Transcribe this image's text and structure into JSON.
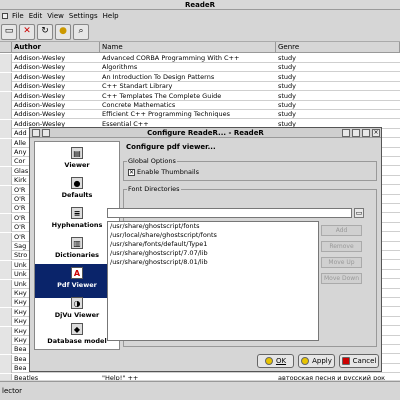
{
  "app": {
    "title": "ReadeR"
  },
  "menu": {
    "items": [
      "File",
      "Edit",
      "View",
      "Settings",
      "Help"
    ]
  },
  "toolbar": {
    "buttons": [
      "new-icon",
      "delete-icon",
      "refresh-icon",
      "search-icon",
      "find-icon"
    ]
  },
  "table": {
    "headers": [
      "Author",
      "Name",
      "Genre"
    ],
    "rows": [
      [
        "Addison-Wesley",
        "Advanced CORBA Programming With C++",
        "study"
      ],
      [
        "Addison-Wesley",
        "Algorithms",
        "study"
      ],
      [
        "Addison-Wesley",
        "An Introduction To Design Patterns",
        "study"
      ],
      [
        "Addison-Wesley",
        "C++ Standart Library",
        "study"
      ],
      [
        "Addison-Wesley",
        "C++ Templates The Complete Guide",
        "study"
      ],
      [
        "Addison-Wesley",
        "Concrete Mathematics",
        "study"
      ],
      [
        "Addison-Wesley",
        "Efficient C++ Programming Techniques",
        "study"
      ],
      [
        "Addison-Wesley",
        "Essential C++",
        "study"
      ],
      [
        "Add",
        "",
        ""
      ],
      [
        "Alle",
        "",
        ""
      ],
      [
        "Any",
        "",
        ""
      ],
      [
        "Cor",
        "",
        ""
      ],
      [
        "Glas",
        "",
        ""
      ],
      [
        "Kirk",
        "",
        ""
      ],
      [
        "O'R",
        "",
        ""
      ],
      [
        "O'R",
        "",
        ""
      ],
      [
        "O'R",
        "",
        ""
      ],
      [
        "O'R",
        "",
        ""
      ],
      [
        "O'R",
        "",
        ""
      ],
      [
        "O'R",
        "",
        ""
      ],
      [
        "Sag",
        "",
        ""
      ],
      [
        "Stro",
        "",
        ""
      ],
      [
        "Unk",
        "",
        ""
      ],
      [
        "Unk",
        "",
        ""
      ],
      [
        "Unk",
        "",
        ""
      ],
      [
        "Кну",
        "",
        ""
      ],
      [
        "Кну",
        "",
        ""
      ],
      [
        "Кну",
        "",
        ""
      ],
      [
        "Кну",
        "",
        ""
      ],
      [
        "Кну",
        "",
        ""
      ],
      [
        "Кну",
        "",
        ""
      ],
      [
        "Bea",
        "",
        ""
      ],
      [
        "Bea",
        "",
        ""
      ],
      [
        "Bea",
        "",
        ""
      ],
      [
        "Beatles",
        "\"Help!\" ++",
        "авторская песня и русский рок"
      ]
    ]
  },
  "statusbar": {
    "text": "lector"
  },
  "dialog": {
    "title": "Configure ReadeR... - ReadeR",
    "header": "Configure pdf viewer...",
    "left_items": [
      {
        "label": "Viewer",
        "icon": "viewer-icon"
      },
      {
        "label": "Defaults",
        "icon": "defaults-icon"
      },
      {
        "label": "Hyphenations",
        "icon": "hyphenations-icon"
      },
      {
        "label": "Dictionaries",
        "icon": "dictionaries-icon"
      },
      {
        "label": "Pdf Viewer",
        "icon": "pdf-icon"
      },
      {
        "label": "DjVu Viewer",
        "icon": "djvu-icon"
      },
      {
        "label": "Database model",
        "icon": "database-icon"
      }
    ],
    "selected": "Pdf Viewer",
    "global_options": {
      "label": "Global Options",
      "checkbox": "Enable Thumbnails",
      "checked": true
    },
    "font_dirs": {
      "label": "Font Directories",
      "input_value": "",
      "list": [
        "/usr/share/ghostscript/fonts",
        "/usr/local/share/ghostscript/fonts",
        "/usr/share/fonts/default/Type1",
        "/usr/share/ghostscript/7.07/lib",
        "/usr/share/ghostscript/8.01/lib"
      ],
      "side_buttons": [
        "Add",
        "Remove",
        "Move Up",
        "Move Down"
      ]
    },
    "buttons": {
      "ok": "OK",
      "apply": "Apply",
      "cancel": "Cancel"
    }
  }
}
